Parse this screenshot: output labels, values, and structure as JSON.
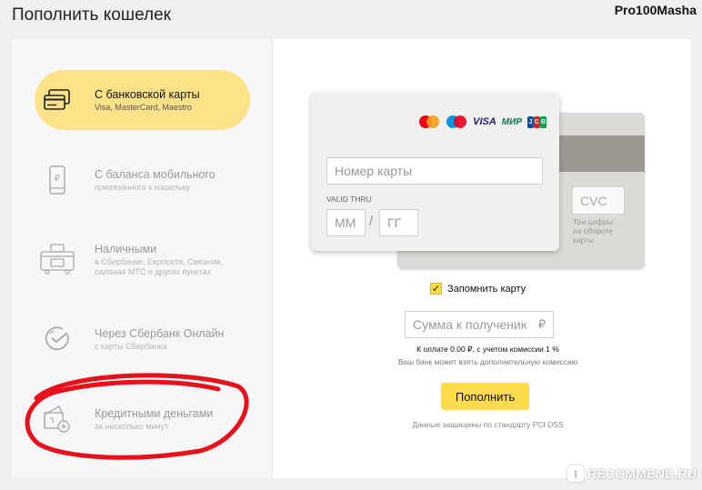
{
  "header": {
    "title": "Пополнить кошелек",
    "username": "Pro100Masha"
  },
  "methods": [
    {
      "label": "С банковской карты",
      "sub": "Visa, MasterCard, Maestro",
      "icon": "bank-card-icon",
      "active": true
    },
    {
      "label": "С баланса мобильного",
      "sub": "привязанного к кошельку",
      "icon": "mobile-phone-icon",
      "active": false
    },
    {
      "label": "Наличными",
      "sub": "в Сбербанке, Евросети, Связном, салонах МТС и других пунктах",
      "sub_lines": [
        "в Сбербанке, Евросети, Связном,",
        "салонах МТС и других пунктах"
      ],
      "icon": "cash-terminal-icon",
      "active": false
    },
    {
      "label": "Через Сбербанк Онлайн",
      "sub": "с карты Сбербанка",
      "icon": "sberbank-icon",
      "active": false
    },
    {
      "label": "Кредитными деньгами",
      "sub": "за несколько минут",
      "icon": "credit-card-plus-icon",
      "active": false
    }
  ],
  "card": {
    "number_placeholder": "Номер карты",
    "valid_label": "VALID THRU",
    "month_placeholder": "ММ",
    "separator": "/",
    "year_placeholder": "ГГ",
    "cvc_placeholder": "CVC",
    "cvc_hint": "Три цифры на обороте карты",
    "cvc_hint_lines": [
      "Три цифры",
      "на обороте",
      "карты"
    ],
    "brand_logos": [
      "mastercard-logo",
      "maestro-logo",
      "visa-logo",
      "mir-logo",
      "jcb-logo"
    ],
    "visa_text": "VISA",
    "mir_text": "МИР",
    "jcb_letters": [
      "J",
      "C",
      "B"
    ]
  },
  "remember": {
    "label": "Запомнить карту",
    "checked": true,
    "check_glyph": "✓"
  },
  "amount": {
    "placeholder": "Сумма к получению",
    "currency": "₽"
  },
  "fee_line": "К оплате 0.00 ₽, с учетом комиссии 1 %",
  "bank_fee_note": "Ваш банк может взять дополнительную комиссию",
  "pay_button": "Пополнить",
  "security_note": "Данные защищены по стандарту PCI DSS",
  "watermark": {
    "badge": "I",
    "text": "RECOMMEND.RU"
  },
  "colors": {
    "accent": "#ffdb4d",
    "active_method_bg": "#fde28a",
    "annotation": "#e8101a"
  }
}
